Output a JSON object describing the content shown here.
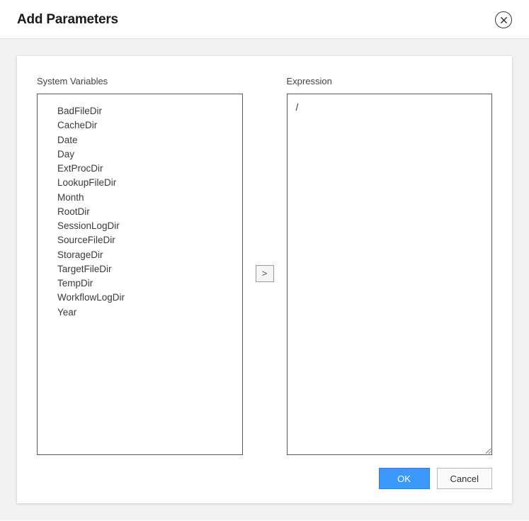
{
  "dialog": {
    "title": "Add Parameters"
  },
  "leftColumn": {
    "label": "System Variables",
    "items": [
      "BadFileDir",
      "CacheDir",
      "Date",
      "Day",
      "ExtProcDir",
      "LookupFileDir",
      "Month",
      "RootDir",
      "SessionLogDir",
      "SourceFileDir",
      "StorageDir",
      "TargetFileDir",
      "TempDir",
      "WorkflowLogDir",
      "Year"
    ]
  },
  "transfer": {
    "label": ">"
  },
  "rightColumn": {
    "label": "Expression",
    "value": "/"
  },
  "buttons": {
    "ok": "OK",
    "cancel": "Cancel"
  }
}
